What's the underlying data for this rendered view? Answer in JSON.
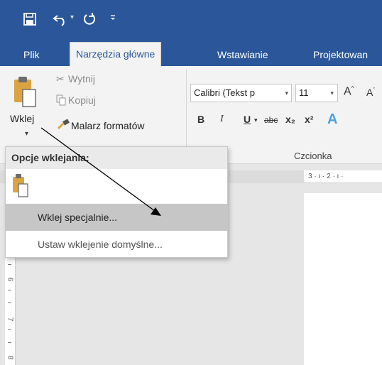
{
  "quick_access": {
    "save_icon": "save-icon",
    "undo_icon": "undo-icon",
    "redo_icon": "redo-icon",
    "customize_icon": "customize-qat-icon"
  },
  "tabs": [
    {
      "label": "Plik"
    },
    {
      "label": "Narzędzia główne"
    },
    {
      "label": "Wstawianie"
    },
    {
      "label": "Projektowan"
    }
  ],
  "clipboard": {
    "paste_label": "Wklej",
    "cut_label": "Wytnij",
    "copy_label": "Kopiuj",
    "format_painter_label": "Malarz formatów"
  },
  "font": {
    "font_name": "Calibri (Tekst p",
    "font_size": "11",
    "bold": "B",
    "italic": "I",
    "underline": "U",
    "strikethrough": "abc",
    "subscript": "x₂",
    "superscript": "x²",
    "text_effects": "A",
    "grow_font": "A",
    "group_label": "Czcionka"
  },
  "paste_menu": {
    "header": "Opcje wklejania:",
    "items": [
      {
        "label": "Wklej specjalnie..."
      },
      {
        "label": "Ustaw wklejenie domyślne..."
      }
    ]
  },
  "rulers": {
    "top_text": "3 · ı · 2 · ı ·",
    "left_numbers": [
      "6",
      "7",
      "8"
    ]
  },
  "colors": {
    "accent": "#2b579a",
    "ribbon": "#f3f3f3",
    "highlight": "#c6c6c6"
  }
}
